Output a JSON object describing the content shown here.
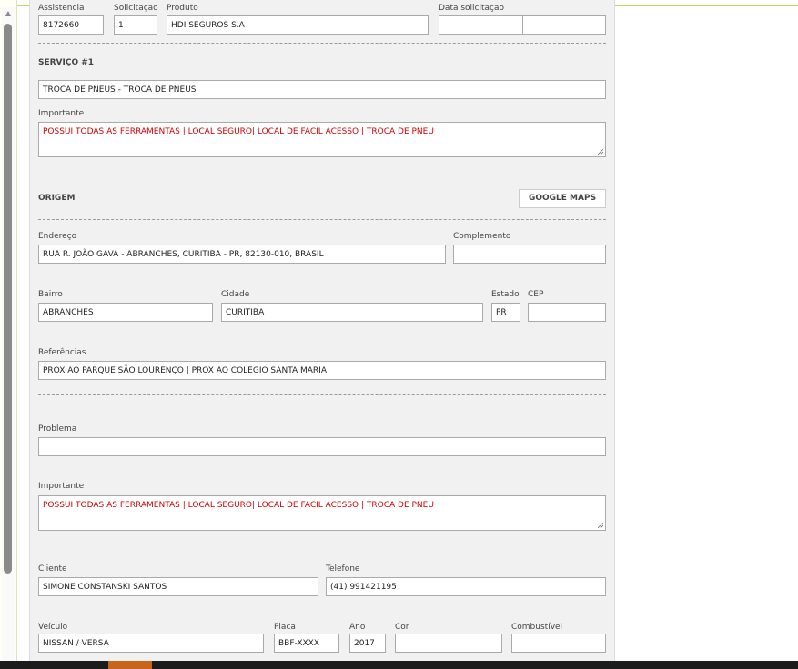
{
  "header": {
    "assistencia_label": "Assistencia",
    "assistencia": "8172660",
    "solicitacao_label": "Solicitaçao",
    "solicitacao": "1",
    "produto_label": "Produto",
    "produto": "HDI SEGUROS S.A",
    "data_label": "Data solicitaçao",
    "data_date": "",
    "data_time": ""
  },
  "servico": {
    "title": "SERVIÇO #1",
    "descricao": "TROCA DE PNEUS - TROCA DE PNEUS",
    "importante_label": "Importante",
    "importante": "POSSUI TODAS AS FERRAMENTAS | LOCAL SEGURO| LOCAL DE FACIL ACESSO | TROCA DE PNEU"
  },
  "origem": {
    "title": "ORIGEM",
    "google_maps": "GOOGLE MAPS",
    "endereco_label": "Endereço",
    "endereco": "RUA R. JOÃO GAVA - ABRANCHES, CURITIBA - PR, 82130-010, BRASIL",
    "complemento_label": "Complemento",
    "complemento": "",
    "bairro_label": "Bairro",
    "bairro": "ABRANCHES",
    "cidade_label": "Cidade",
    "cidade": "CURITIBA",
    "estado_label": "Estado",
    "estado": "PR",
    "cep_label": "CEP",
    "cep": "",
    "referencias_label": "Referências",
    "referencias": "PROX AO PARQUE SÃO LOURENÇO | PROX AO COLEGIO SANTA MARIA"
  },
  "problema": {
    "label": "Problema",
    "value": "",
    "importante_label": "Importante",
    "importante": "POSSUI TODAS AS FERRAMENTAS | LOCAL SEGURO| LOCAL DE FACIL ACESSO | TROCA DE PNEU"
  },
  "cliente": {
    "cliente_label": "Cliente",
    "cliente": "SIMONE CONSTANSKI SANTOS",
    "telefone_label": "Telefone",
    "telefone": "(41) 991421195"
  },
  "veiculo": {
    "veiculo_label": "Veículo",
    "veiculo": "NISSAN / VERSA",
    "placa_label": "Placa",
    "placa": "BBF-XXXX",
    "ano_label": "Ano",
    "ano": "2017",
    "cor_label": "Cor",
    "cor": "",
    "combustivel_label": "Combustível",
    "combustivel": ""
  }
}
